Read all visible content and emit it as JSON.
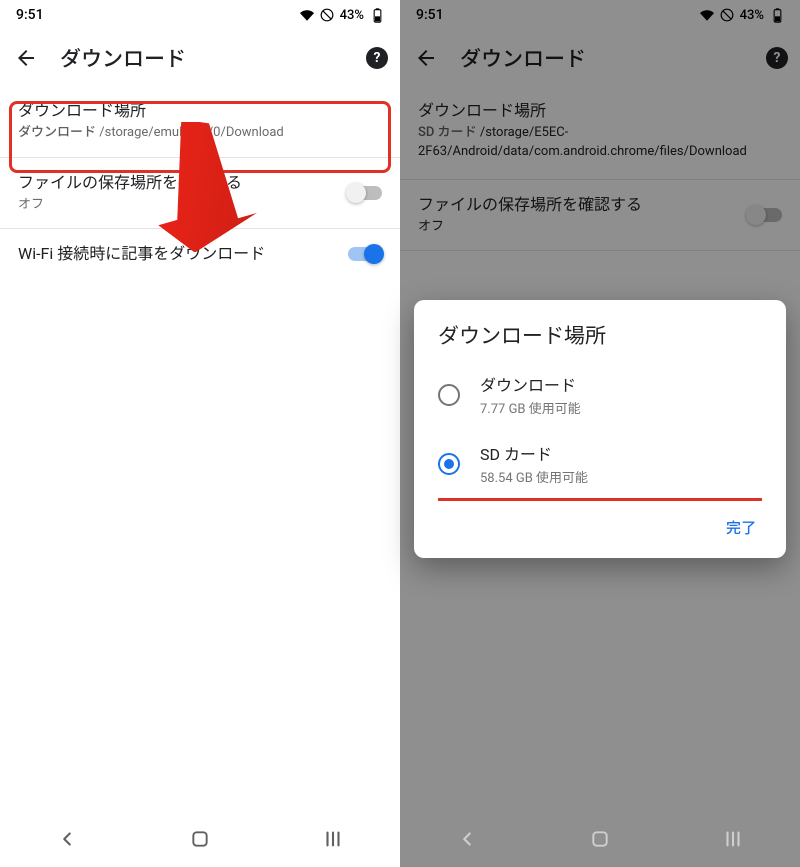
{
  "status": {
    "time": "9:51",
    "battery_text": "43%"
  },
  "left": {
    "header": {
      "title": "ダウンロード"
    },
    "location": {
      "label": "ダウンロード場所",
      "value_prefix": "ダウンロード",
      "value_path": "/storage/emulated/0/Download"
    },
    "confirm": {
      "label": "ファイルの保存場所を確認する",
      "state": "オフ"
    },
    "wifi": {
      "label": "Wi-Fi 接続時に記事をダウンロード"
    }
  },
  "right": {
    "header": {
      "title": "ダウンロード"
    },
    "location": {
      "label": "ダウンロード場所",
      "value_prefix": "SD カード",
      "value_path": "/storage/E5EC-2F63/Android/data/com.android.chrome/files/Download"
    },
    "confirm": {
      "label": "ファイルの保存場所を確認する",
      "state": "オフ"
    },
    "dialog": {
      "title": "ダウンロード場所",
      "options": [
        {
          "name": "ダウンロード",
          "capacity": "7.77 GB 使用可能",
          "selected": false
        },
        {
          "name": "SD カード",
          "capacity": "58.54 GB 使用可能",
          "selected": true
        }
      ],
      "done": "完了"
    }
  }
}
